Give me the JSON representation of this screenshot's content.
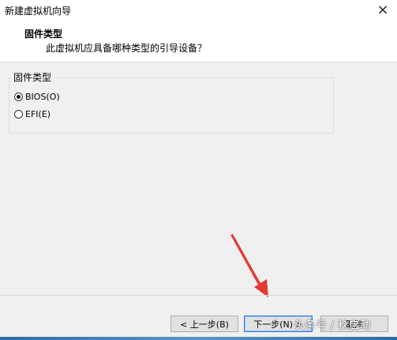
{
  "window": {
    "title": "新建虚拟机向导",
    "close_glyph": "×"
  },
  "header": {
    "title": "固件类型",
    "subtitle": "此虚拟机应具备哪种类型的引导设备？"
  },
  "firmware_group": {
    "legend": "固件类型",
    "options": [
      {
        "label": "BIOS(O)",
        "checked": true
      },
      {
        "label": "EFI(E)",
        "checked": false
      }
    ]
  },
  "annotation": {
    "arrow_color": "#e53935"
  },
  "buttons": {
    "back": "< 上一步(B)",
    "next": "下一步(N) >",
    "cancel": "取消"
  },
  "watermark": "头条号 / 秋启动"
}
